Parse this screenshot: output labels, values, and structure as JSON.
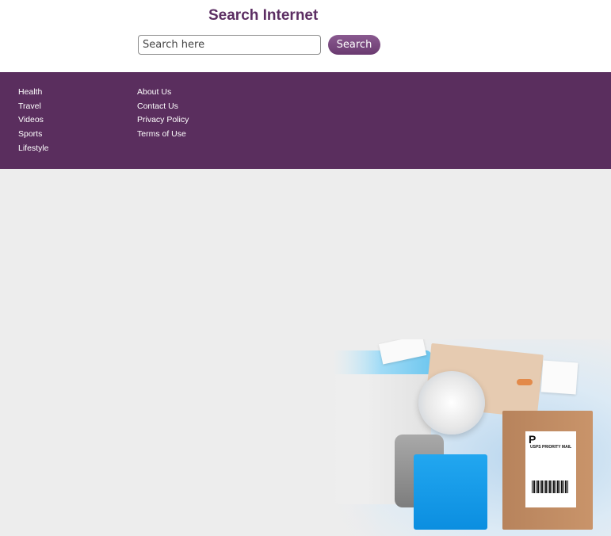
{
  "search": {
    "title": "Search Internet",
    "placeholder": "Search here",
    "button_label": "Search"
  },
  "footer": {
    "left_links": [
      "Health",
      "Travel",
      "Videos",
      "Sports",
      "Lifestyle"
    ],
    "right_links": [
      "About Us",
      "Contact Us",
      "Privacy Policy",
      "Terms of Use"
    ]
  },
  "hero": {
    "label_letter": "P",
    "label_text": "USPS PRIORITY MAIL"
  },
  "colors": {
    "brand": "#5a2e5e",
    "title": "#5c2e63",
    "background": "#ededed"
  }
}
